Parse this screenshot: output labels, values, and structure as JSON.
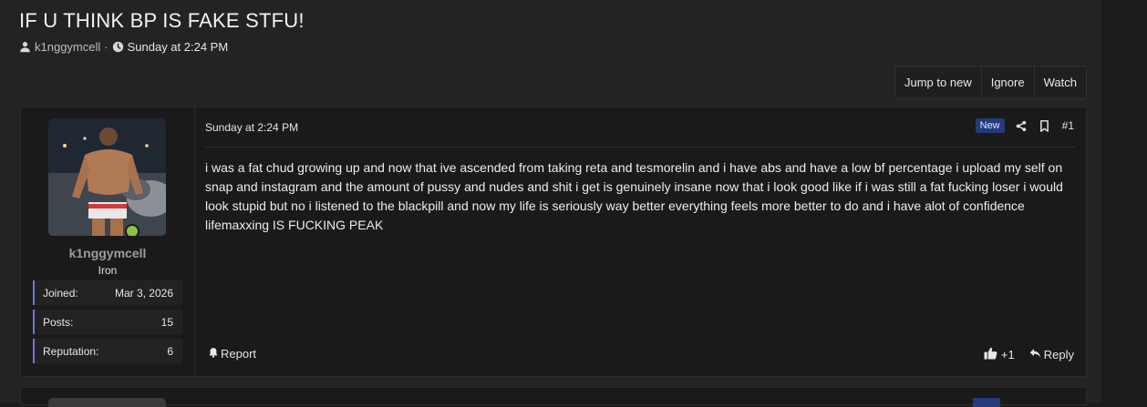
{
  "thread": {
    "title": "IF U THINK BP IS FAKE STFU!",
    "author": "k1nggymcell",
    "separator": "·",
    "date": "Sunday at 2:24 PM"
  },
  "actions": {
    "jump_to_new": "Jump to new",
    "ignore": "Ignore",
    "watch": "Watch"
  },
  "post": {
    "date": "Sunday at 2:24 PM",
    "badge": "New",
    "number": "#1",
    "body": "i was a fat chud growing up and now that ive ascended from taking reta and tesmorelin and i have abs and have a low bf percentage i upload my self on snap and instagram and the amount of pussy and nudes and shit i get is genuinely insane now that i look good like if i was still a fat fucking loser i would look stupid but no i listened to the blackpill and now my life is seriously way better everything feels more better to do and i have alot of confidence lifemaxxing IS FUCKING PEAK",
    "report_label": "Report",
    "reaction_count": "+1",
    "reply_label": "Reply"
  },
  "user": {
    "name": "k1nggymcell",
    "rank": "Iron",
    "stats": [
      {
        "label": "Joined:",
        "value": "Mar 3, 2026"
      },
      {
        "label": "Posts:",
        "value": "15"
      },
      {
        "label": "Reputation:",
        "value": "6"
      }
    ]
  },
  "colors": {
    "accent": "#6f74d8",
    "badge_new": "#243a7a",
    "online": "#8bc34a"
  },
  "icons": [
    "user-icon",
    "clock-icon",
    "share-icon",
    "bookmark-icon",
    "bell-icon",
    "thumbs-up-icon",
    "reply-icon"
  ]
}
